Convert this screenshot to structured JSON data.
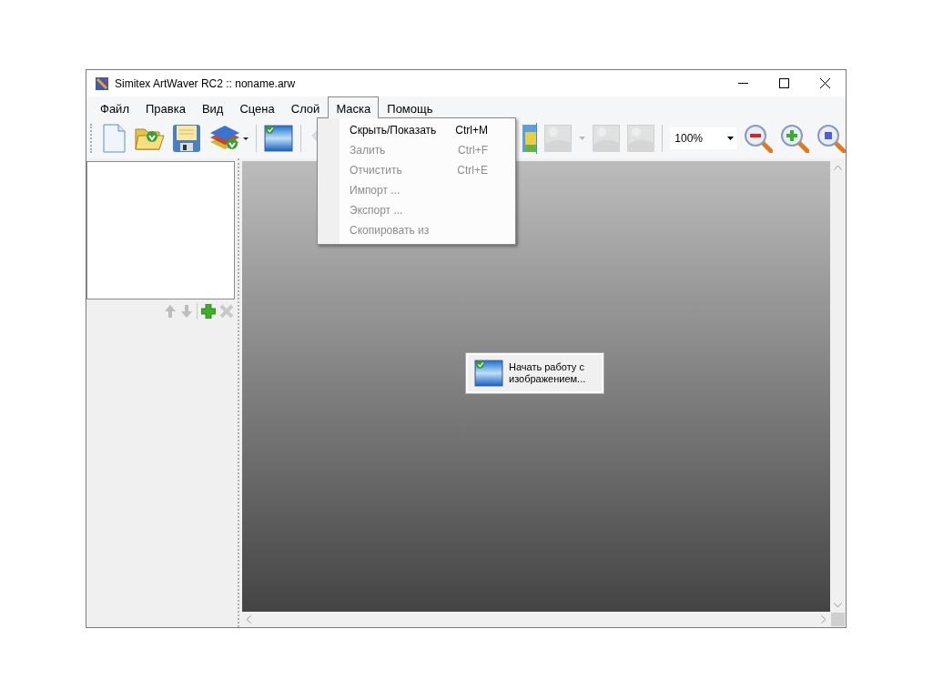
{
  "window": {
    "title": "Simitex ArtWaver RC2 :: noname.arw"
  },
  "menu": [
    {
      "label": "Файл",
      "selected": false
    },
    {
      "label": "Правка",
      "selected": false
    },
    {
      "label": "Вид",
      "selected": false
    },
    {
      "label": "Сцена",
      "selected": false
    },
    {
      "label": "Слой",
      "selected": false
    },
    {
      "label": "Маска",
      "selected": true
    },
    {
      "label": "Помощь",
      "selected": false
    }
  ],
  "dropdown": [
    {
      "label": "Скрыть/Показать",
      "shortcut": "Ctrl+M",
      "disabled": false
    },
    {
      "label": "Залить",
      "shortcut": "Ctrl+F",
      "disabled": true
    },
    {
      "label": "Отчистить",
      "shortcut": "Ctrl+E",
      "disabled": true
    },
    {
      "label": "Импорт ...",
      "disabled": true
    },
    {
      "label": "Экспорт ...",
      "disabled": true
    },
    {
      "label": "Скопировать из",
      "disabled": true
    }
  ],
  "toolbar": {
    "left": [
      {
        "kind": "new",
        "disabled": false
      },
      {
        "kind": "open",
        "disabled": false
      },
      {
        "kind": "save",
        "disabled": false
      },
      {
        "kind": "layers",
        "disabled": false
      },
      {
        "kind": "sep"
      },
      {
        "kind": "image",
        "disabled": false
      },
      {
        "kind": "sep"
      },
      {
        "kind": "undo",
        "disabled": true
      }
    ],
    "right": [
      {
        "kind": "edge",
        "disabled": false
      },
      {
        "kind": "filter",
        "disabled": true
      },
      {
        "kind": "caret",
        "disabled": true
      },
      {
        "kind": "filter",
        "disabled": true
      },
      {
        "kind": "filter",
        "disabled": true
      },
      {
        "kind": "sep"
      }
    ],
    "zoom": {
      "value": "100%"
    },
    "zoom_buttons": [
      {
        "kind": "zoom-out"
      },
      {
        "kind": "zoom-in"
      },
      {
        "kind": "zoom-fit"
      }
    ]
  },
  "layer_panel": {
    "buttons": [
      {
        "kind": "up",
        "disabled": true
      },
      {
        "kind": "down",
        "disabled": true
      },
      {
        "kind": "sep"
      },
      {
        "kind": "add",
        "disabled": false
      },
      {
        "kind": "delete",
        "disabled": true
      }
    ]
  },
  "start_button": {
    "label": "Начать работу с изображением..."
  }
}
